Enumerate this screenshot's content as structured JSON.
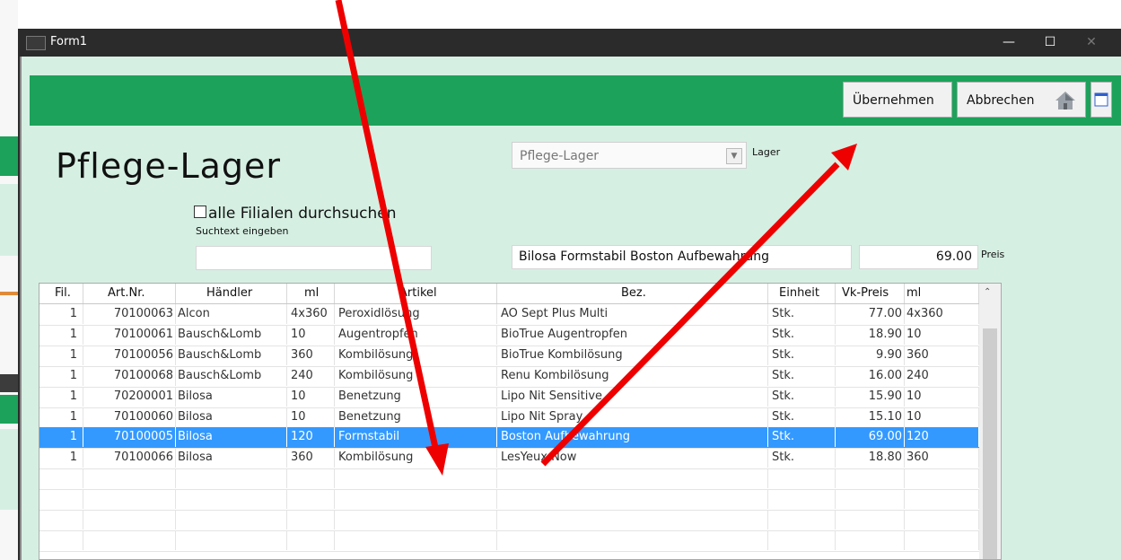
{
  "window": {
    "title": "Form1",
    "controls": [
      "—",
      "☐",
      "✕"
    ]
  },
  "toolbar": {
    "accept_label": "Übernehmen",
    "cancel_label": "Abbrechen"
  },
  "form": {
    "title": "Pflege-Lager",
    "all_branches_label": "alle Filialen durchsuchen",
    "search_label": "Suchtext eingeben",
    "search_value": "",
    "warehouse_value": "Pflege-Lager",
    "warehouse_label": "Lager",
    "article_value": "Bilosa Formstabil Boston Aufbewahrung",
    "price_value": "69.00",
    "price_label": "Preis"
  },
  "grid": {
    "headers": [
      "Fil.",
      "Art.Nr.",
      "Händler",
      "ml",
      "Artikel",
      "Bez.",
      "Einheit",
      "Vk-Preis",
      "ml"
    ],
    "rows": [
      [
        "1",
        "70100063",
        "Alcon",
        "4x360",
        "Peroxidlösung",
        "AO Sept Plus Multi",
        "Stk.",
        "77.00",
        "4x360"
      ],
      [
        "1",
        "70100061",
        "Bausch&Lomb",
        "10",
        "Augentropfen",
        "BioTrue Augentropfen",
        "Stk.",
        "18.90",
        "10"
      ],
      [
        "1",
        "70100056",
        "Bausch&Lomb",
        "360",
        "Kombilösung",
        "BioTrue Kombilösung",
        "Stk.",
        "9.90",
        "360"
      ],
      [
        "1",
        "70100068",
        "Bausch&Lomb",
        "240",
        "Kombilösung",
        "Renu Kombilösung",
        "Stk.",
        "16.00",
        "240"
      ],
      [
        "1",
        "70200001",
        "Bilosa",
        "10",
        "Benetzung",
        "Lipo Nit Sensitive",
        "Stk.",
        "15.90",
        "10"
      ],
      [
        "1",
        "70100060",
        "Bilosa",
        "10",
        "Benetzung",
        "Lipo Nit Spray",
        "Stk.",
        "15.10",
        "10"
      ],
      [
        "1",
        "70100005",
        "Bilosa",
        "120",
        "Formstabil",
        "Boston Aufbewahrung",
        "Stk.",
        "69.00",
        "120"
      ],
      [
        "1",
        "70100066",
        "Bilosa",
        "360",
        "Kombilösung",
        "LesYeux Now",
        "Stk.",
        "18.80",
        "360"
      ]
    ],
    "selected_row": 6
  },
  "colors": {
    "accent_green": "#1ca25a",
    "panel_bg": "#d6efe3",
    "selection": "#3399ff",
    "annotation_red": "#ee0000"
  },
  "icons": {
    "home": "home-icon",
    "window": "window-icon",
    "scroll_up": "scroll-up-icon"
  }
}
